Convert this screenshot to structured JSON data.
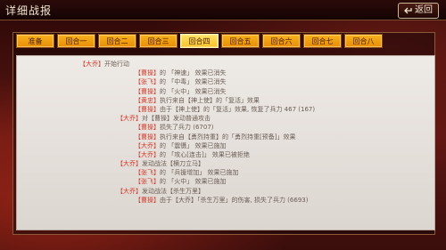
{
  "header": {
    "title": "详细战报",
    "back_label": "返回"
  },
  "tabs": [
    "准备",
    "回合一",
    "回合二",
    "回合三",
    "回合四",
    "回合五",
    "回合六",
    "回合七",
    "回合八"
  ],
  "active_tab_index": 4,
  "log": [
    {
      "level": 0,
      "tag": "【大乔】",
      "text": "开始行动"
    },
    {
      "level": 2,
      "tag": "【曹操】",
      "text": "的 「神速」 效果已消失"
    },
    {
      "level": 2,
      "tag": "【张飞】",
      "text": "的 「中毒」 效果已消失"
    },
    {
      "level": 2,
      "tag": "【曹操】",
      "text": "的 「火中」 效果已消失"
    },
    {
      "level": 2,
      "tag": "【黄忠】",
      "text": "执行来自【神上使】的「复活」效果"
    },
    {
      "level": 2,
      "tag": "【曹操】",
      "text": "由于【神上使】的「复活」效果, 恢复了兵力 467 (167)"
    },
    {
      "level": 1,
      "tag": "【大乔】",
      "text": "对【曹操】发动普通攻击"
    },
    {
      "level": 2,
      "tag": "【曹操】",
      "text": "损失了兵力 (6707)"
    },
    {
      "level": 2,
      "tag": "【曹操】",
      "text": "执行来自【勇烈持重】的「勇烈持重[预备]」效果"
    },
    {
      "level": 2,
      "tag": "【大乔】",
      "text": "的 「震慑」 效果已施加"
    },
    {
      "level": 2,
      "tag": "【大乔】",
      "text": "的 「攻心[连击]」 效果已被拒绝"
    },
    {
      "level": 1,
      "tag": "【大乔】",
      "text": "发动战法【横刀立马】"
    },
    {
      "level": 2,
      "tag": "【张飞】",
      "text": "的 「兵援增加」 效果已施加"
    },
    {
      "level": 2,
      "tag": "【张飞】",
      "text": "的 「火中」 效果已施加"
    },
    {
      "level": 1,
      "tag": "【大乔】",
      "text": "发动战法【杀生万里】"
    },
    {
      "level": 2,
      "tag": "【曹操】",
      "text": "由于【大乔】「杀生万里」的伤害, 损失了兵力 (6693)"
    }
  ]
}
